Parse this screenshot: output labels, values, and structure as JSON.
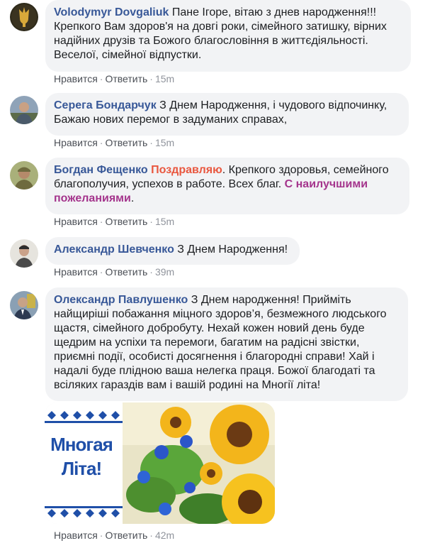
{
  "actions": {
    "like": "Нравится",
    "reply": "Ответить",
    "separator": "·"
  },
  "comments": [
    {
      "author": "Volodymyr Dovgaliuk",
      "lines": [
        " Пане Ігоре, вітаю з днев народження!!!",
        "Крепкого Вам здоров'я на довгі роки, сімейного затишку, вірних",
        "надійних друзів та Божого благословіння в життєдіяльності.",
        "Веселої, сімейної відпустки."
      ],
      "time": "15m"
    },
    {
      "author": "Серега Бондарчук",
      "lines": [
        " З Днем Народження, і чудового відпочинку,",
        "Бажаю нових перемог в задуманих справах,"
      ],
      "time": "15m"
    },
    {
      "author": "Богдан Фещенко",
      "hl1": "Поздравляю",
      "text1": ". Крепкого здоровья, семейного",
      "line2": "благополучия, успехов в работе. Всех благ. ",
      "hl2a": "С наилучшими",
      "hl2b": "пожеланиями",
      "tail": ".",
      "time": "15m"
    },
    {
      "author": "Александр Шевченко",
      "lines": [
        " З Днем Народження!"
      ],
      "time": "39m"
    },
    {
      "author": "Олександр Павлушенко",
      "lines": [
        " З Днем народження! Прийміть",
        "найщиріші побажання міцного здоров’я, безмежного людського",
        "щастя, сімейного добробуту. Нехай кожен новий день буде",
        "щедрим на успіхи та перемоги, багатим на радісні звістки,",
        "приємні події, особисті досягнення і благородні справи! Хай і",
        "надалі буде плідною ваша нелегка праця. Божої благодаті та",
        "всіляких гараздів вам і вашій родині на Многії літа!"
      ],
      "time": "42m",
      "card_text_1": "Многая",
      "card_text_2": "Літа!"
    }
  ],
  "colors": {
    "author": "#385898",
    "bubble": "#f2f3f5",
    "accent_red": "#e9573f",
    "accent_purple": "#a4348c"
  }
}
